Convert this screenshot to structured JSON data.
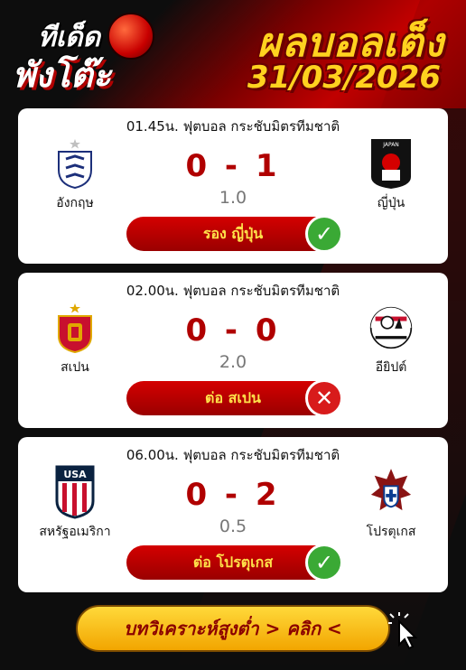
{
  "header": {
    "logo_line1": "ทีเด็ด",
    "logo_line2": "พังโต๊ะ",
    "title": "ผลบอลเต็ง",
    "date": "31/03/2026"
  },
  "matches": [
    {
      "time_league": "01.45น. ฟุตบอล กระชับมิตรทีมชาติ",
      "home": "อังกฤษ",
      "away": "ญี่ปุ่น",
      "score": "0 - 1",
      "handicap": "1.0",
      "tip": "รอง ญี่ปุ่น",
      "result": "win",
      "result_icon": "check-icon"
    },
    {
      "time_league": "02.00น. ฟุตบอล กระชับมิตรทีมชาติ",
      "home": "สเปน",
      "away": "อียิปต์",
      "score": "0 - 0",
      "handicap": "2.0",
      "tip": "ต่อ สเปน",
      "result": "lose",
      "result_icon": "cross-icon"
    },
    {
      "time_league": "06.00น. ฟุตบอล กระชับมิตรทีมชาติ",
      "home": "สหรัฐอเมริกา",
      "away": "โปรตุเกส",
      "score": "0 - 2",
      "handicap": "0.5",
      "tip": "ต่อ โปรตุเกส",
      "result": "win",
      "result_icon": "check-icon"
    }
  ],
  "crest_text": {
    "japan": "JAPAN",
    "usa": "USA"
  },
  "cta": {
    "label": "บทวิเคราะห์สูงต่ำ > คลิก <"
  },
  "colors": {
    "accent_red": "#b00000",
    "gold": "#ffd21f",
    "win_green": "#3aa935",
    "lose_red": "#d81b1b"
  }
}
